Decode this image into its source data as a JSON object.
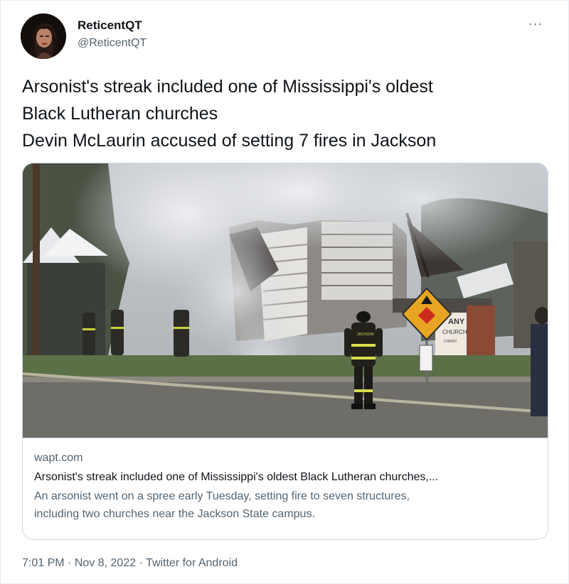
{
  "tweet": {
    "display_name": "ReticentQT",
    "handle": "@ReticentQT",
    "more_icon": "more-horizontal-icon",
    "text_lines": [
      "Arsonist's streak included one of Mississippi's oldest",
      "Black Lutheran churches",
      "Devin McLaurin accused of setting 7 fires in Jackson"
    ]
  },
  "card": {
    "domain": "wapt.com",
    "title": "Arsonist's streak included one of Mississippi's oldest Black Lutheran churches,...",
    "description_lines": [
      "An arsonist went on a spree early Tuesday, setting fire to seven structures,",
      "including two churches near the Jackson State campus."
    ],
    "image_sign_text": [
      "ANY",
      "CHURCH",
      "CHRIST"
    ],
    "firefighter_jacket_text": "JACKSON"
  },
  "footer": {
    "time": "7:01 PM",
    "separator": "·",
    "date": "Nov 8, 2022",
    "source": "Twitter for Android"
  },
  "colors": {
    "text_primary": "#0f1419",
    "text_secondary": "#536471",
    "border": "#cfd9de",
    "sign_yellow": "#e8a523",
    "sign_red": "#cc2a1e"
  }
}
